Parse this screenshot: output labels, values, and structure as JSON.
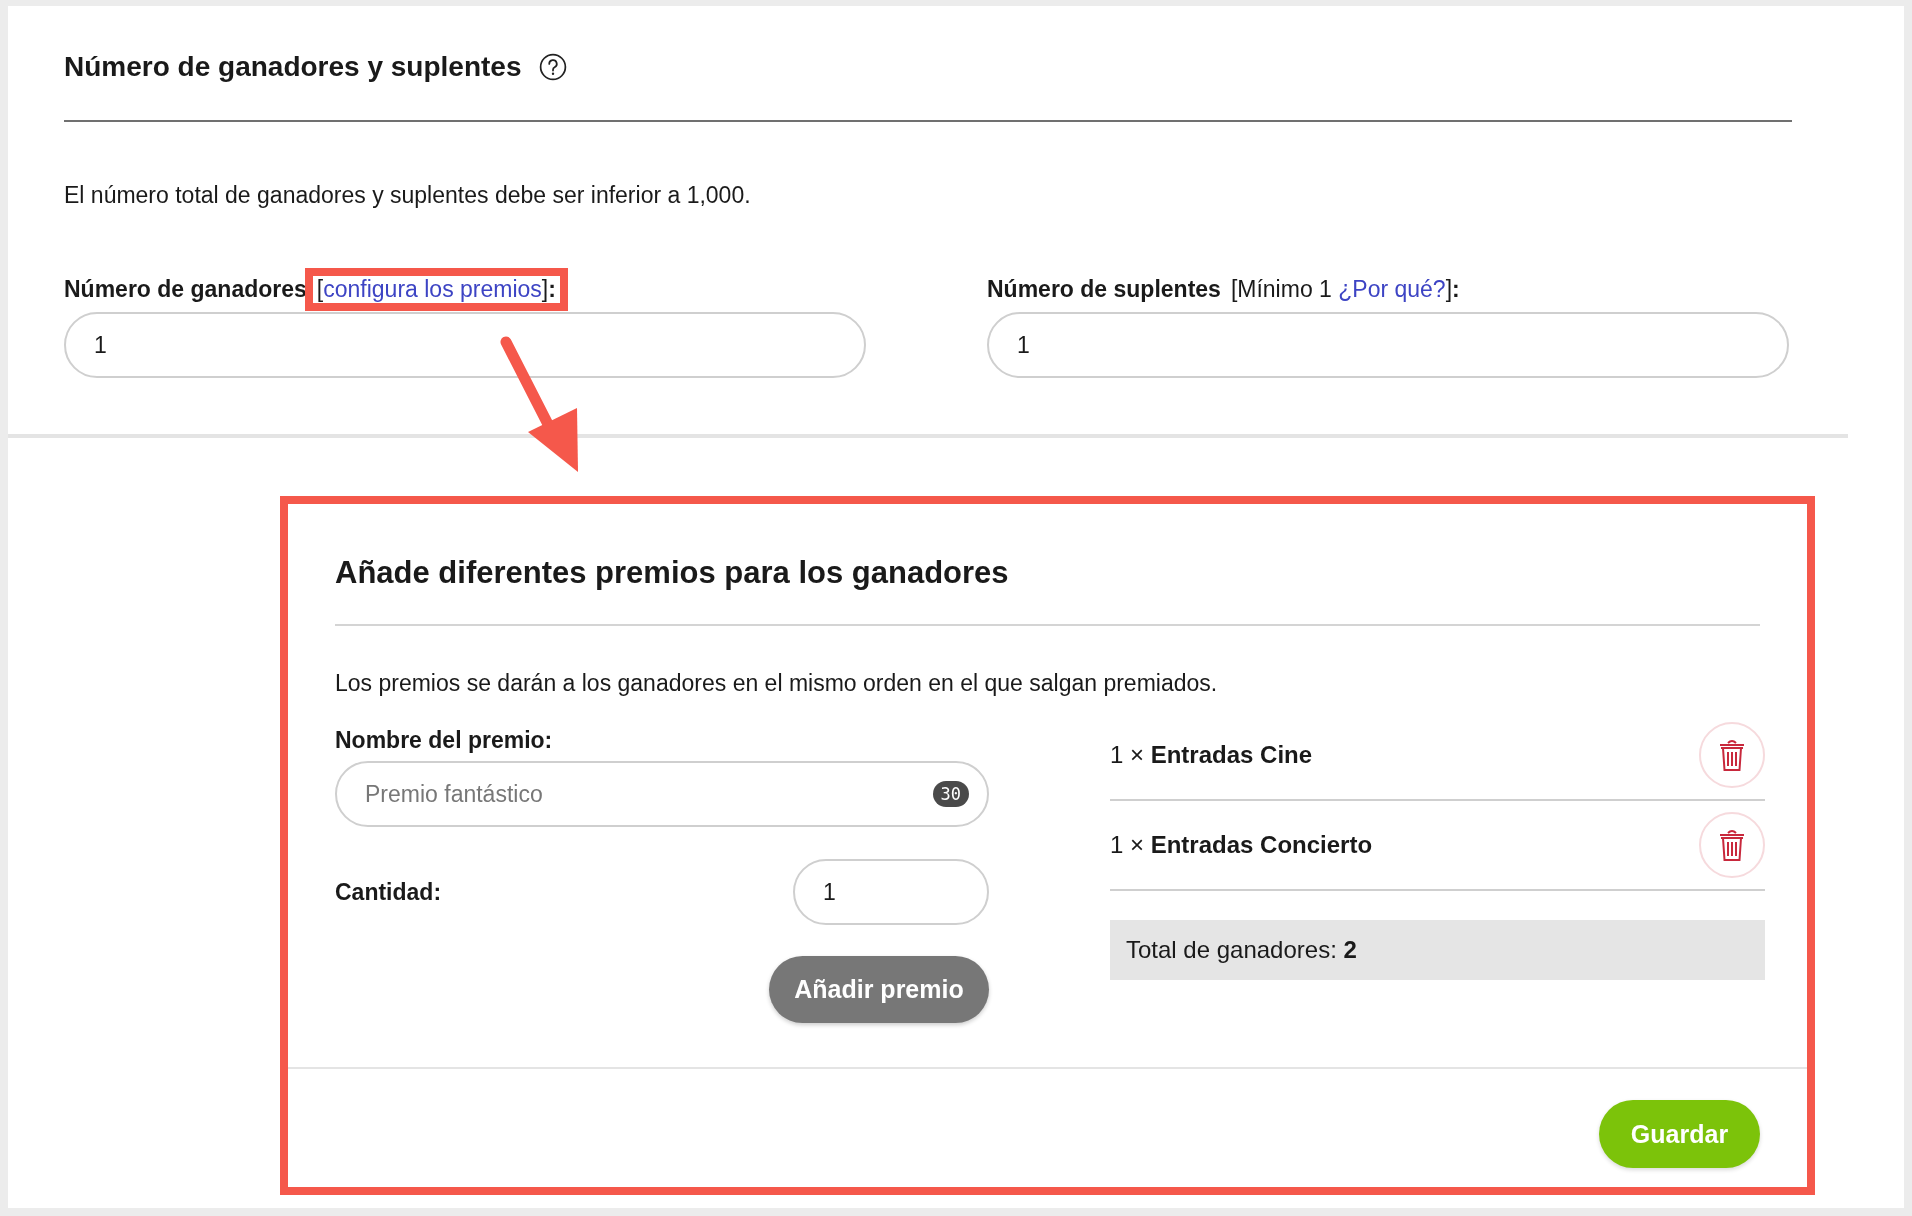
{
  "section": {
    "title": "Número de ganadores y suplentes",
    "note": "El número total de ganadores y suplentes debe ser inferior a 1,000."
  },
  "fields": [
    {
      "label": "Número de ganadores",
      "prefix": "[",
      "link": "configura los premios",
      "suffix": "]**:**",
      "value": "1",
      "highlighted": true
    },
    {
      "label": "Número de suplentes",
      "prefix": "[Mínimo 1 ",
      "link": "¿Por qué?",
      "suffix": "]**:**",
      "value": "1",
      "highlighted": false
    }
  ],
  "prizes_dialog": {
    "highlighted": true,
    "title": "Añade diferentes premios para los ganadores",
    "description": "Los premios se darán a los ganadores en el mismo orden en el que salgan premiados.",
    "name_label": "Nombre del premio:",
    "name_placeholder": "Premio fantástico",
    "char_count": "30",
    "quantity_label": "Cantidad:",
    "quantity_value": "1",
    "add_button": "Añadir premio",
    "prizes": [
      {
        "text": "1 × **Entradas Cine**"
      },
      {
        "text": "1 × **Entradas Concierto**"
      }
    ],
    "total": "Total de ganadores: **2**",
    "save_button": "Guardar"
  }
}
